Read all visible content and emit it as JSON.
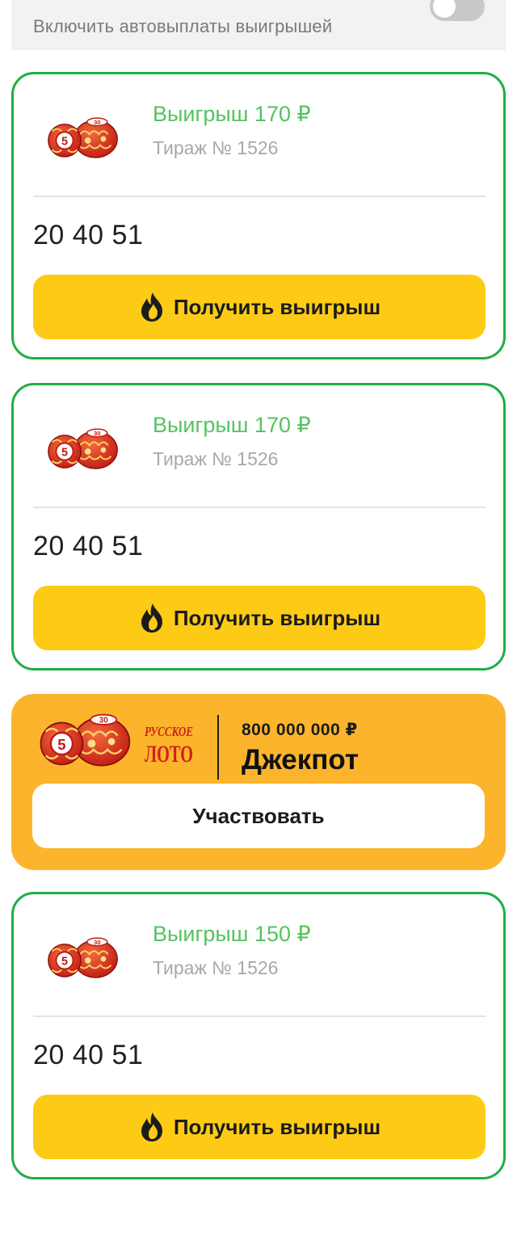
{
  "autopay": {
    "label": "Включить автовыплаты выигрышей",
    "enabled": false
  },
  "cards": [
    {
      "win": "Выигрыш 170 ₽",
      "draw": "Тираж № 1526",
      "numbers": "20 40 51",
      "button": "Получить выигрыш"
    },
    {
      "win": "Выигрыш 170 ₽",
      "draw": "Тираж № 1526",
      "numbers": "20 40 51",
      "button": "Получить выигрыш"
    },
    {
      "win": "Выигрыш 150 ₽",
      "draw": "Тираж № 1526",
      "numbers": "20 40 51",
      "button": "Получить выигрыш"
    }
  ],
  "jackpot": {
    "brand": "РУССКОЕ ЛОТО",
    "amount": "800 000 000 ₽",
    "title": "Джекпот",
    "button": "Участвовать"
  },
  "icons": {
    "card_logo": "lotto-barrels-icon",
    "button_icon": "fire-icon"
  },
  "colors": {
    "accent_green": "#1fae44",
    "win_text": "#55c35f",
    "button_yellow": "#fdcb16",
    "jackpot_bg": "#fbb42c"
  }
}
